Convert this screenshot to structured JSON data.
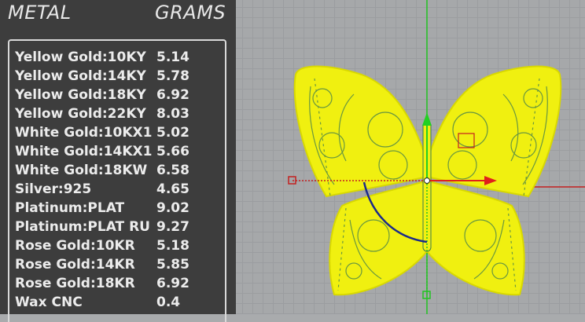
{
  "header": {
    "metal_label": "METAL",
    "grams_label": "GRAMS"
  },
  "weights": [
    {
      "metal": "Yellow Gold:10KY",
      "grams": "5.14"
    },
    {
      "metal": "Yellow Gold:14KY",
      "grams": "5.78"
    },
    {
      "metal": "Yellow Gold:18KY",
      "grams": "6.92"
    },
    {
      "metal": "Yellow Gold:22KY",
      "grams": "8.03"
    },
    {
      "metal": "White Gold:10KX1",
      "grams": "5.02"
    },
    {
      "metal": "White Gold:14KX1",
      "grams": "5.66"
    },
    {
      "metal": "White Gold:18KW",
      "grams": "6.58"
    },
    {
      "metal": "Silver:925",
      "grams": "4.65"
    },
    {
      "metal": "Platinum:PLAT",
      "grams": "9.02"
    },
    {
      "metal": "Platinum:PLAT RU",
      "grams": "9.27"
    },
    {
      "metal": "Rose Gold:10KR",
      "grams": "5.18"
    },
    {
      "metal": "Rose Gold:14KR",
      "grams": "5.85"
    },
    {
      "metal": "Rose Gold:18KR",
      "grams": "6.92"
    },
    {
      "metal": "Wax  CNC",
      "grams": "0.4"
    }
  ],
  "viewport": {
    "model": "butterfly-pendant",
    "colors": {
      "wireframe": "#ffff1a",
      "accent": "#2f6f4a",
      "x_axis": "#e0201c",
      "y_axis": "#22d022",
      "rotate_arc": "#1a2a8a"
    }
  }
}
